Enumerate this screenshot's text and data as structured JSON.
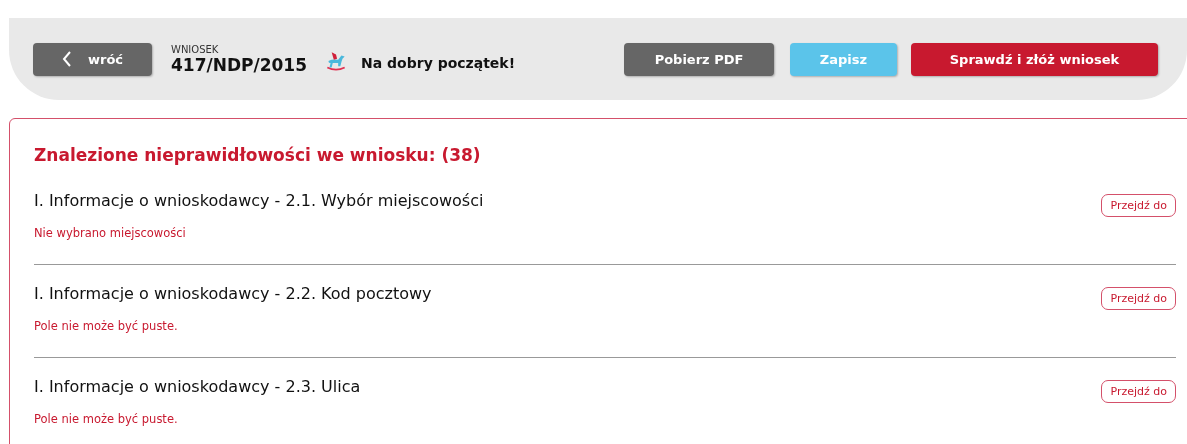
{
  "header": {
    "back_button": "wróć",
    "application_label": "WNIOSEK",
    "application_number": "417/NDP/2015",
    "program_name": "Na dobry początek!",
    "buttons": [
      {
        "kind": "secondary",
        "label": "Pobierz PDF"
      },
      {
        "kind": "save",
        "label": "Zapisz"
      },
      {
        "kind": "primary",
        "label": "Sprawdź i złóż wniosek"
      }
    ]
  },
  "errors_panel": {
    "title": "Znalezione nieprawidłowości we wniosku: (38)",
    "items": [
      {
        "field": "I. Informacje o wnioskodawcy - 2.1. Wybór miejscowości",
        "message": "Nie wybrano miejscowości",
        "action": "Przejdź do"
      },
      {
        "field": "I. Informacje o wnioskodawcy - 2.2. Kod pocztowy",
        "message": "Pole nie może być puste.",
        "action": "Przejdź do"
      },
      {
        "field": "I. Informacje o wnioskodawcy - 2.3. Ulica",
        "message": "Pole nie może być puste.",
        "action": "Przejdź do"
      }
    ]
  }
}
